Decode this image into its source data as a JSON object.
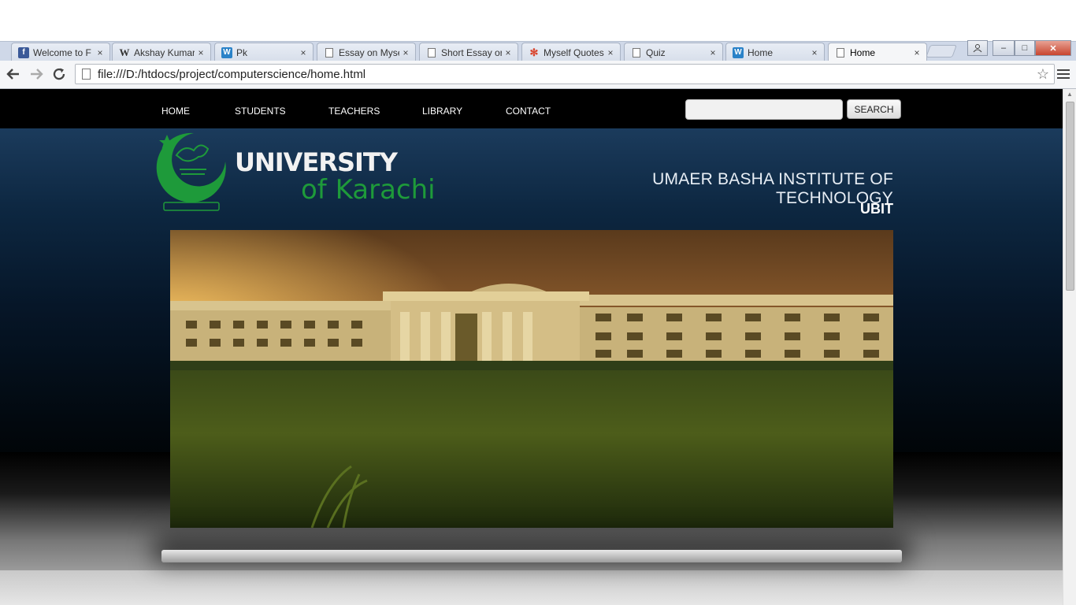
{
  "browser": {
    "tabs": [
      {
        "title": "Welcome to F",
        "icon": "facebook-icon",
        "active": false
      },
      {
        "title": "Akshay Kumar",
        "icon": "wikipedia-icon",
        "active": false
      },
      {
        "title": "Pk",
        "icon": "weebly-icon",
        "active": false
      },
      {
        "title": "Essay on Myse",
        "icon": "page-icon",
        "active": false
      },
      {
        "title": "Short Essay or",
        "icon": "page-icon",
        "active": false
      },
      {
        "title": "Myself Quotes",
        "icon": "pinwheel-icon",
        "active": false
      },
      {
        "title": "Quiz",
        "icon": "page-icon",
        "active": false
      },
      {
        "title": "Home",
        "icon": "weebly-icon",
        "active": false
      },
      {
        "title": "Home",
        "icon": "page-icon",
        "active": true
      }
    ],
    "close_glyph": "×",
    "url": "file:///D:/htdocs/project/computerscience/home.html",
    "window_controls": {
      "minimize": "–",
      "maximize": "□",
      "close": "✕"
    }
  },
  "site": {
    "nav": {
      "home": "HOME",
      "students": "STUDENTS",
      "teachers": "TEACHERS",
      "library": "LIBRARY",
      "contact": "CONTACT"
    },
    "search": {
      "placeholder": "",
      "button": "SEARCH"
    },
    "logo": {
      "line1": "UNIVERSITY",
      "line2": "of Karachi"
    },
    "institute_name": "UMAER BASHA INSTITUTE OF TECHNOLOGY",
    "institute_short": "UBIT"
  },
  "colors": {
    "nav_bg": "#000000",
    "banner_top": "#1b3b5c",
    "logo_green": "#1e9a3a"
  }
}
